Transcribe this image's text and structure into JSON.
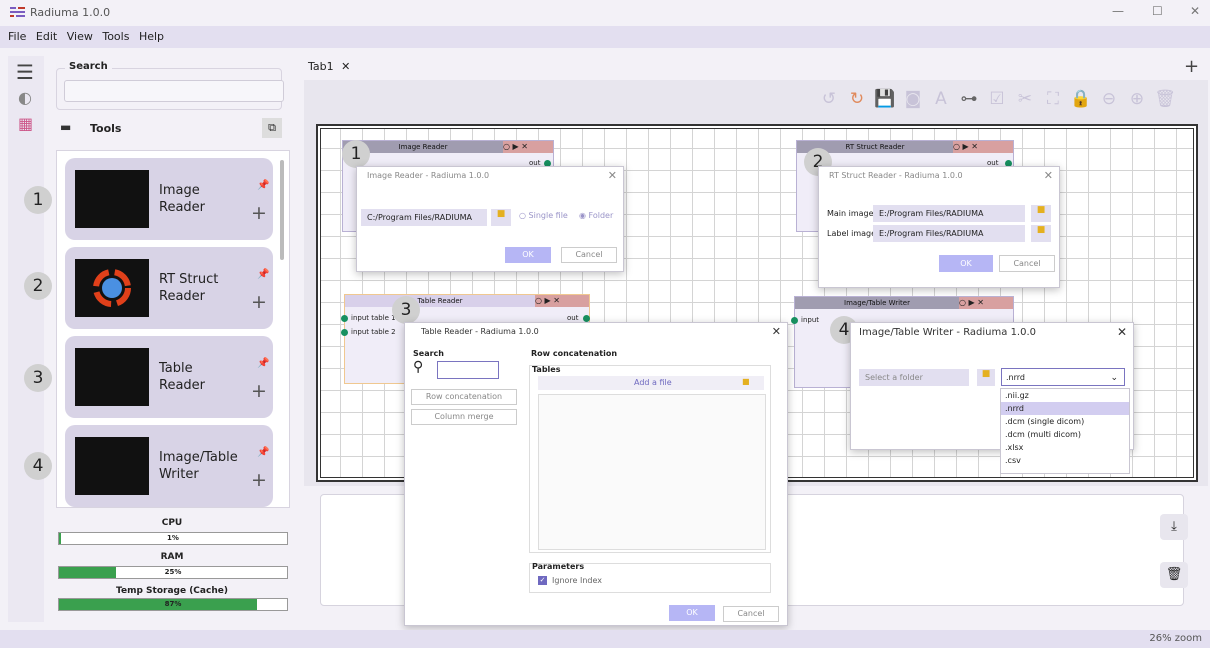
{
  "window": {
    "title": "Radiuma 1.0.0"
  },
  "menu": [
    "File",
    "Edit",
    "View",
    "Tools",
    "Help"
  ],
  "sidebar": {
    "search_label": "Search",
    "search_placeholder": "",
    "tools_label": "Tools",
    "tools": [
      {
        "num": "1",
        "label": "Image Reader"
      },
      {
        "num": "2",
        "label": "RT Struct Reader"
      },
      {
        "num": "3",
        "label": "Table Reader"
      },
      {
        "num": "4",
        "label": "Image/Table Writer"
      }
    ]
  },
  "resources": {
    "cpu": {
      "label": "CPU",
      "value": "1%",
      "fraction": 0.01
    },
    "ram": {
      "label": "RAM",
      "value": "25%",
      "fraction": 0.25
    },
    "temp": {
      "label": "Temp Storage (Cache)",
      "value": "87%",
      "fraction": 0.87
    }
  },
  "tab": {
    "label": "Tab1",
    "close": "✕"
  },
  "toolbar_icons": [
    "undo-icon",
    "redo-icon",
    "save-icon",
    "screenshot-icon",
    "text-icon",
    "align-icon",
    "check-icon",
    "cut-icon",
    "fit-icon",
    "lock-icon",
    "zoom-out-icon",
    "zoom-in-icon",
    "trash-icon"
  ],
  "nodes": {
    "image_reader": {
      "title": "Image Reader",
      "out": "out",
      "num": "1"
    },
    "rt_struct_reader": {
      "title": "RT Struct Reader",
      "out": "out",
      "num": "2"
    },
    "table_reader": {
      "title": "Table Reader",
      "in1": "input table 1",
      "in2": "input table 2",
      "out": "out",
      "num": "3"
    },
    "writer": {
      "title": "Image/Table Writer",
      "in": "input",
      "num": "4"
    }
  },
  "dialogs": {
    "image_reader": {
      "title": "Image Reader - Radiuma 1.0.0",
      "path": "C:/Program Files/RADIUMA",
      "opt1": "Single file",
      "opt2": "Folder",
      "ok": "OK",
      "cancel": "Cancel"
    },
    "rt_struct": {
      "title": "RT Struct Reader - Radiuma 1.0.0",
      "main_label": "Main image",
      "main_path": "E:/Program Files/RADIUMA",
      "label_label": "Label image",
      "label_path": "E:/Program Files/RADIUMA",
      "ok": "OK",
      "cancel": "Cancel"
    },
    "table_reader": {
      "title": "Table Reader - Radiuma 1.0.0",
      "search": "Search",
      "btn1": "Row concatenation",
      "btn2": "Column merge",
      "section": "Row concatenation",
      "tables": "Tables",
      "add_file": "Add a file",
      "params": "Parameters",
      "ignore_index": "Ignore Index",
      "ok": "OK",
      "cancel": "Cancel"
    },
    "writer": {
      "title": "Image/Table Writer - Radiuma 1.0.0",
      "folder_placeholder": "Select a folder",
      "selected": ".nrrd",
      "options": [
        ".nii.gz",
        ".nrrd",
        ".dcm (single dicom)",
        ".dcm (multi dicom)",
        ".xlsx",
        ".csv"
      ]
    }
  },
  "status": {
    "zoom": "26% zoom"
  }
}
